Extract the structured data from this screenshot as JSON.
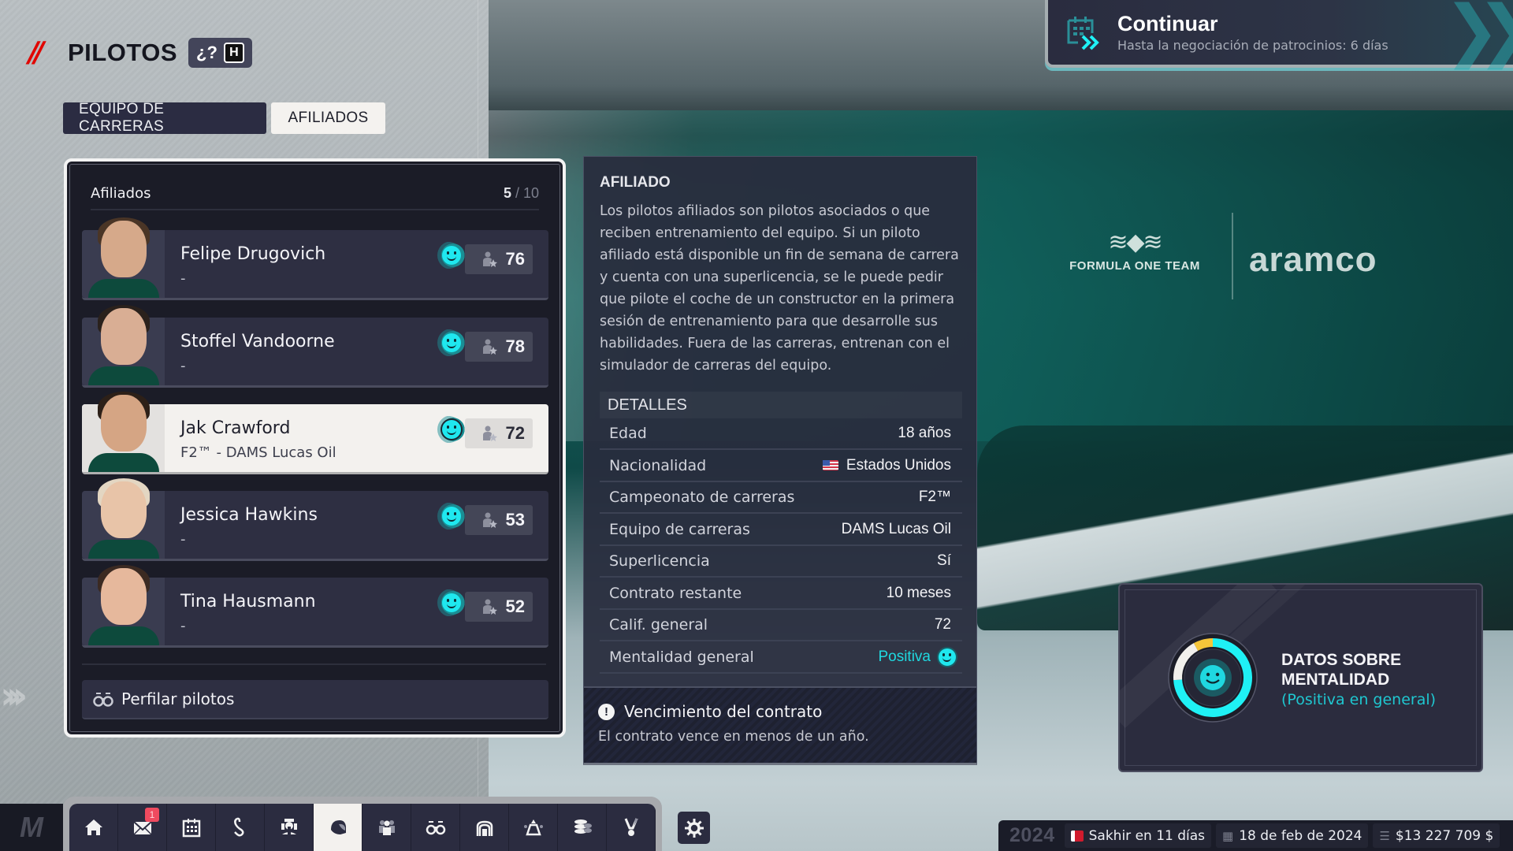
{
  "header": {
    "title": "PILOTOS",
    "help_label": "¿?",
    "help_key": "H"
  },
  "tabs": [
    {
      "label": "EQUIPO DE CARRERAS",
      "active": false
    },
    {
      "label": "AFILIADOS",
      "active": true
    }
  ],
  "continue_button": {
    "title": "Continuar",
    "subtitle": "Hasta la negociación de patrocinios: 6 días",
    "icon": "calendar-advance-icon"
  },
  "affiliates_panel": {
    "title": "Afiliados",
    "count": "5",
    "max": "10",
    "drivers": [
      {
        "name": "Felipe Drugovich",
        "team": "-",
        "mood": "positive",
        "rating": "76",
        "selected": false,
        "skin": "#d6a98a",
        "hair": "#4a3526"
      },
      {
        "name": "Stoffel Vandoorne",
        "team": "-",
        "mood": "positive",
        "rating": "78",
        "selected": false,
        "skin": "#d9ae94",
        "hair": "#2a211c"
      },
      {
        "name": "Jak Crawford",
        "team": "F2™ - DAMS Lucas Oil",
        "mood": "positive",
        "rating": "72",
        "selected": true,
        "skin": "#d5a584",
        "hair": "#2d2018"
      },
      {
        "name": "Jessica Hawkins",
        "team": "-",
        "mood": "positive",
        "rating": "53",
        "selected": false,
        "skin": "#e8c4a8",
        "hair": "#e3d6c2"
      },
      {
        "name": "Tina Hausmann",
        "team": "-",
        "mood": "positive",
        "rating": "52",
        "selected": false,
        "skin": "#e6b89c",
        "hair": "#3b2a22"
      }
    ],
    "scout_button": "Perfilar pilotos"
  },
  "detail_panel": {
    "heading": "AFILIADO",
    "description": "Los pilotos afiliados son pilotos asociados o que reciben entrenamiento del equipo. Si un piloto afiliado está disponible un fin de semana de carrera y cuenta con una superlicencia, se le puede pedir que pilote el coche de un constructor en la primera sesión de entrenamiento para que desarrolle sus habilidades. Fuera de las carreras, entrenan con el simulador de carreras del equipo.",
    "details_heading": "DETALLES",
    "details": [
      {
        "label": "Edad",
        "value": "18 años"
      },
      {
        "label": "Nacionalidad",
        "value": "Estados Unidos",
        "flag": "us"
      },
      {
        "label": "Campeonato de carreras",
        "value": "F2™"
      },
      {
        "label": "Equipo de carreras",
        "value": "DAMS Lucas Oil"
      },
      {
        "label": "Superlicencia",
        "value": "Sí"
      },
      {
        "label": "Contrato restante",
        "value": "10 meses"
      },
      {
        "label": "Calif. general",
        "value": "72"
      },
      {
        "label": "Mentalidad general",
        "value": "Positiva",
        "highlight": true
      }
    ],
    "warning": {
      "title": "Vencimiento del contrato",
      "text": "El contrato vence en menos de un año."
    }
  },
  "mentality_panel": {
    "title_line1": "DATOS SOBRE",
    "title_line2": "MENTALIDAD",
    "subtitle": "(Positiva en general)",
    "breakdown": [
      {
        "mood": "positive",
        "fraction": 0.74,
        "color": "#1ff1f5"
      },
      {
        "mood": "neutral",
        "fraction": 0.18,
        "color": "#f2f0ec"
      },
      {
        "mood": "negative",
        "fraction": 0.08,
        "color": "#f5c53a"
      }
    ]
  },
  "background": {
    "sponsor_1_wings": "ASTON MARTIN",
    "sponsor_1_text": "FORMULA ONE TEAM",
    "sponsor_2_text": "aramco"
  },
  "bottom_nav": {
    "items": [
      {
        "name": "home",
        "active": false
      },
      {
        "name": "mail",
        "active": false,
        "badge": "1"
      },
      {
        "name": "calendar",
        "active": false
      },
      {
        "name": "circuit",
        "active": false
      },
      {
        "name": "car-development",
        "active": false
      },
      {
        "name": "drivers",
        "active": true
      },
      {
        "name": "staff",
        "active": false
      },
      {
        "name": "scouting",
        "active": false
      },
      {
        "name": "facilities",
        "active": false
      },
      {
        "name": "team-morale",
        "active": false
      },
      {
        "name": "finances",
        "active": false
      },
      {
        "name": "sponsors",
        "active": false
      }
    ]
  },
  "status_bar": {
    "year": "2024",
    "next_race": "Sakhir en 11 días",
    "date": "18 de feb de 2024",
    "money": "$13 227 709 $"
  }
}
